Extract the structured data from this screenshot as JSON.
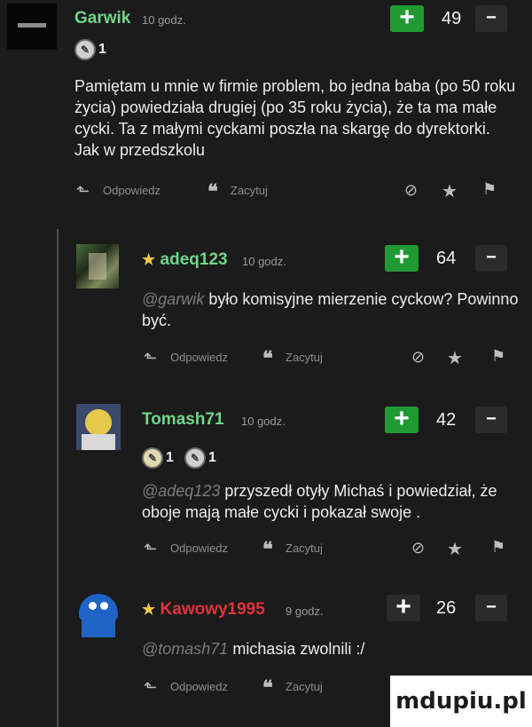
{
  "comments": [
    {
      "username": "Garwik",
      "time": "10 godz.",
      "votes": "49",
      "badges": [
        "1"
      ],
      "mention": "",
      "text": "Pamiętam u mnie w firmie problem, bo jedna baba (po 50 roku życia) powiedziała drugiej (po 35 roku życia), że ta ma małe cycki. Ta z małymi cyckami poszła na skargę do dyrektorki. Jak w przedszkolu",
      "color": "#6fd68a"
    },
    {
      "username": "adeq123",
      "time": "10 godz.",
      "votes": "64",
      "badges": [],
      "mention": "@garwik",
      "text": "było komisyjne mierzenie cyckow? Powinno być.",
      "color": "#6fd68a"
    },
    {
      "username": "Tomash71",
      "time": "10 godz.",
      "votes": "42",
      "badges": [
        "1",
        "1"
      ],
      "mention": "@adeq123",
      "text": "przyszedł otyły Michaś i powiedział, że oboje mają małe cycki i pokazał swoje .",
      "color": "#6fd68a"
    },
    {
      "username": "Kawowy1995",
      "time": "9 godz.",
      "votes": "26",
      "badges": [],
      "mention": "@tomash71",
      "text": "michasia zwolnili :/",
      "color": "#e0323c"
    }
  ],
  "actions": {
    "reply": "Odpowiedz",
    "quote": "Zacytuj"
  },
  "vote": {
    "plus": "+",
    "minus": "−"
  },
  "icons": {
    "reply": "reply-arrow-icon",
    "quote": "quote-icon",
    "mod": "moderate-icon",
    "star": "star-icon",
    "flag": "flag-icon"
  },
  "watermark": "mdupiu.pl",
  "colors": {
    "accent_green": "#1f9a33",
    "name_green": "#6fd68a",
    "name_red": "#e0323c",
    "background": "#1b1b1b"
  }
}
